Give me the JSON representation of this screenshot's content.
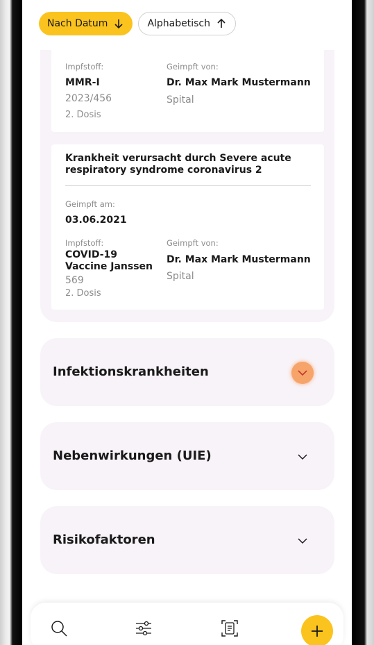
{
  "sort": {
    "by_date_label": "Nach Datum",
    "alphabetical_label": "Alphabetisch"
  },
  "vaccinations": [
    {
      "vaccine_label": "Impfstoff:",
      "vaccine_name": "MMR-I",
      "lot": "2023/456",
      "dose": "2. Dosis",
      "vaccinated_by_label": "Geimpft von:",
      "doctor": "Dr. Max Mark Mustermann",
      "place": "Spital"
    },
    {
      "disease": "Krankheit verursacht durch Severe acute respiratory syndrome coronavirus 2",
      "date_label": "Geimpft am:",
      "date": "03.06.2021",
      "vaccine_label": "Impfstoff:",
      "vaccine_name_line1": "COVID-19",
      "vaccine_name_line2": "Vaccine Janssen",
      "lot": "569",
      "dose": "2. Dosis",
      "vaccinated_by_label": "Geimpft von:",
      "doctor": "Dr. Max Mark Mustermann",
      "place": "Spital"
    }
  ],
  "sections": [
    {
      "title": "Infektionskrankheiten",
      "icon": "chevron-down-icon",
      "highlighted": true
    },
    {
      "title": "Nebenwirkungen (UIE)",
      "icon": "chevron-down-icon",
      "highlighted": false
    },
    {
      "title": "Risikofaktoren",
      "icon": "chevron-down-icon",
      "highlighted": false
    }
  ],
  "bottom_bar": {
    "icons": [
      "search-icon",
      "filter-sliders-icon",
      "document-scan-icon",
      "plus-icon"
    ]
  },
  "colors": {
    "accent": "#fbc31e",
    "section_bg": "#f8f3f8",
    "highlight": "#f7a46a"
  }
}
